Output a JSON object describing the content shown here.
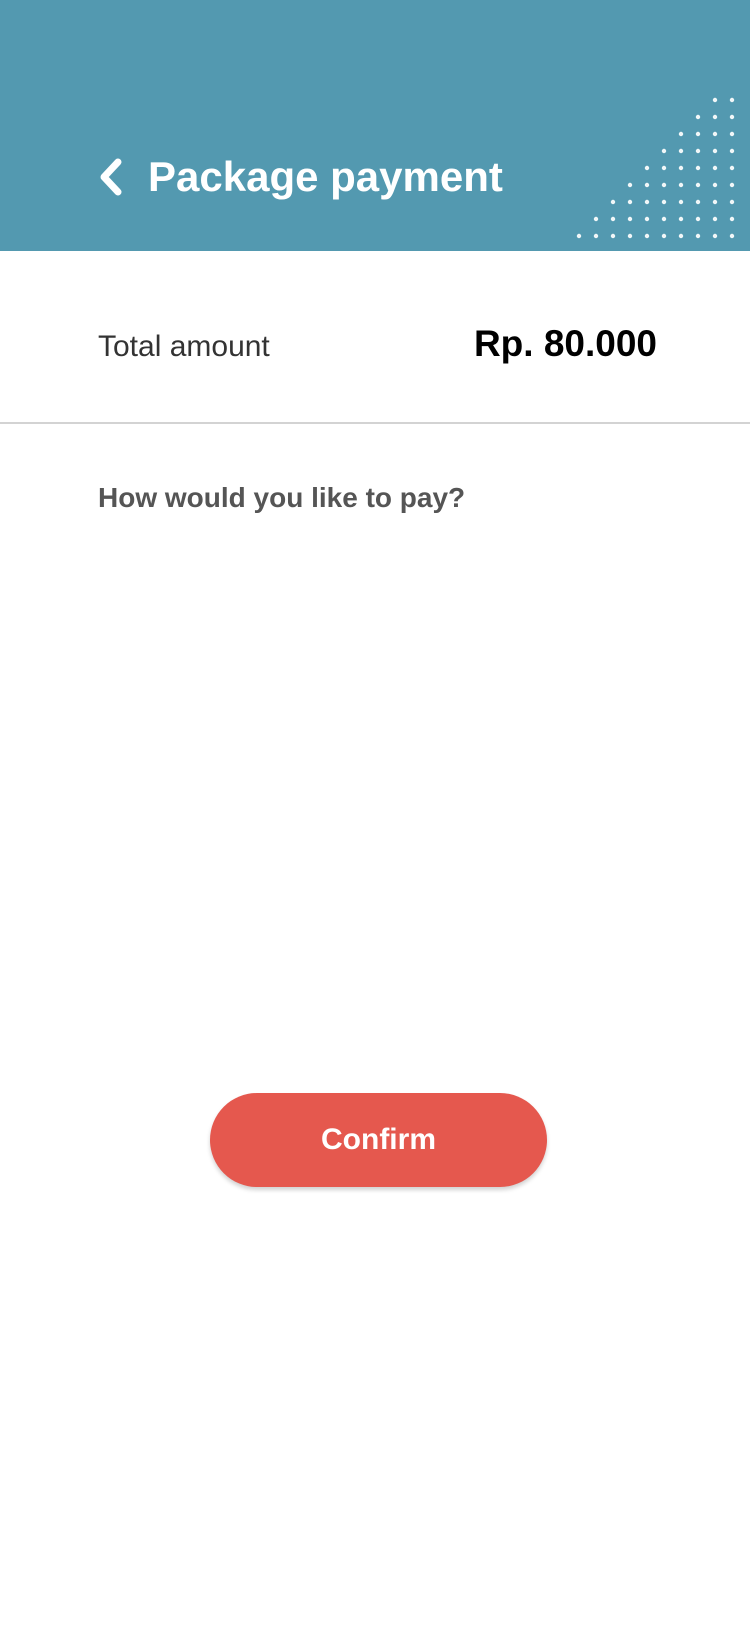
{
  "header": {
    "title": "Package payment",
    "back_icon": "chevron-left-icon",
    "background_color": "#5399b0"
  },
  "summary": {
    "total_label": "Total amount",
    "total_value": "Rp. 80.000"
  },
  "payment": {
    "question": "How would you like to pay?"
  },
  "actions": {
    "confirm_label": "Confirm",
    "confirm_color": "#e5584e"
  }
}
